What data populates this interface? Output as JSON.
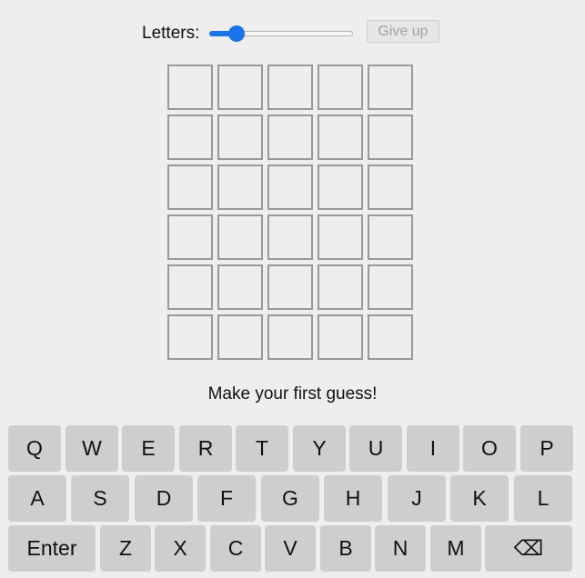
{
  "controls": {
    "letters_label": "Letters:",
    "letters_slider_level": 0.19,
    "give_up_label": "Give up"
  },
  "board": {
    "rows": 6,
    "columns": 5,
    "tiles": [
      [
        "",
        "",
        "",
        "",
        ""
      ],
      [
        "",
        "",
        "",
        "",
        ""
      ],
      [
        "",
        "",
        "",
        "",
        ""
      ],
      [
        "",
        "",
        "",
        "",
        ""
      ],
      [
        "",
        "",
        "",
        "",
        ""
      ],
      [
        "",
        "",
        "",
        "",
        ""
      ]
    ]
  },
  "message": "Make your first guess!",
  "keyboard": {
    "rows": [
      [
        "Q",
        "W",
        "E",
        "R",
        "T",
        "Y",
        "U",
        "I",
        "O",
        "P"
      ],
      [
        "A",
        "S",
        "D",
        "F",
        "G",
        "H",
        "J",
        "K",
        "L"
      ],
      [
        "Enter",
        "Z",
        "X",
        "C",
        "V",
        "B",
        "N",
        "M",
        "⌫"
      ]
    ]
  },
  "colors": {
    "background": "#eeeeee",
    "key": "#cecece",
    "tile_border": "#999999",
    "slider_accent": "#1a73e8"
  }
}
